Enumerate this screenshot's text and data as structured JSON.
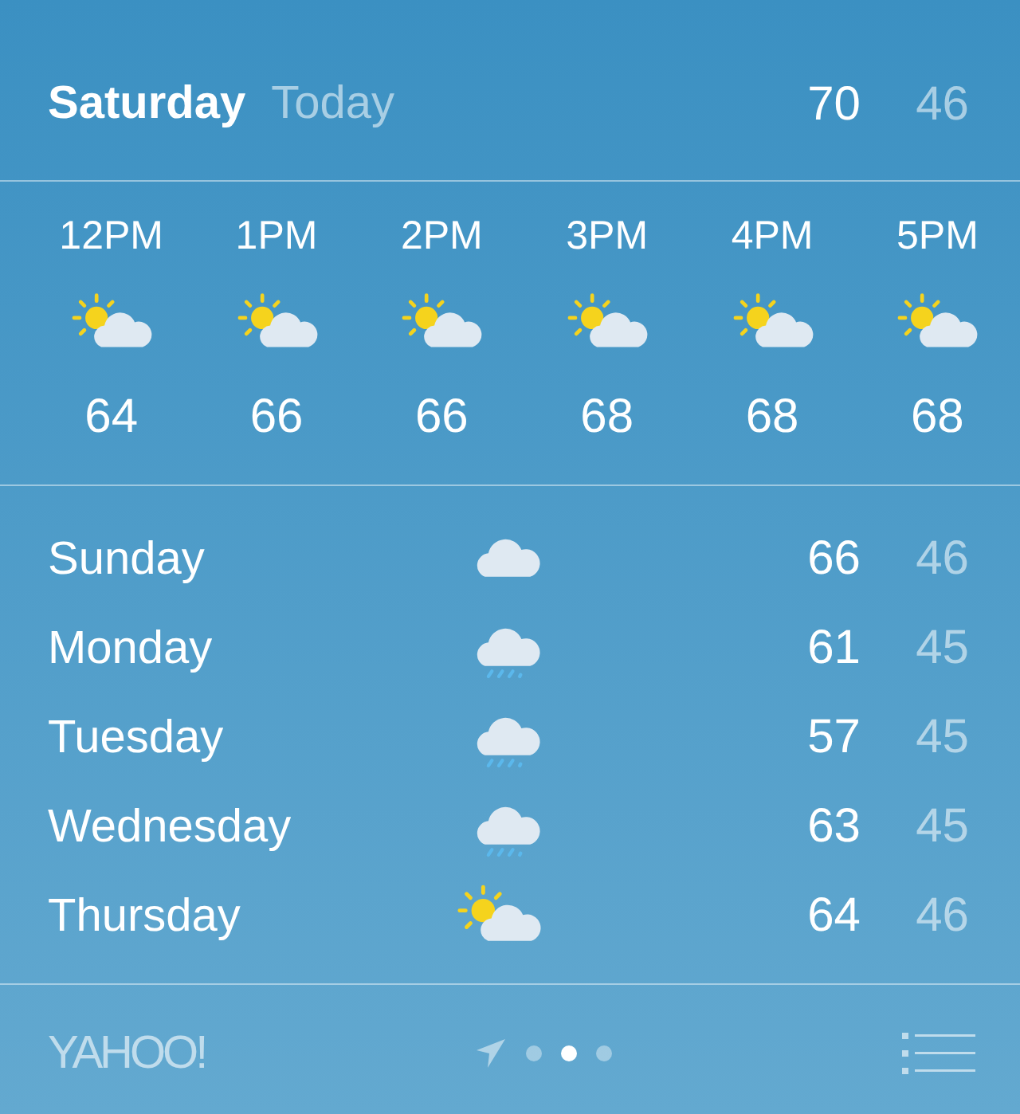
{
  "today": {
    "day": "Saturday",
    "label": "Today",
    "high": "70",
    "low": "46"
  },
  "hourly": [
    {
      "time": "12PM",
      "kind": "partly-cloudy",
      "temp": "64"
    },
    {
      "time": "1PM",
      "kind": "partly-cloudy",
      "temp": "66"
    },
    {
      "time": "2PM",
      "kind": "partly-cloudy",
      "temp": "66"
    },
    {
      "time": "3PM",
      "kind": "partly-cloudy",
      "temp": "68"
    },
    {
      "time": "4PM",
      "kind": "partly-cloudy",
      "temp": "68"
    },
    {
      "time": "5PM",
      "kind": "partly-cloudy",
      "temp": "68"
    }
  ],
  "daily": [
    {
      "day": "Sunday",
      "kind": "cloudy",
      "high": "66",
      "low": "46"
    },
    {
      "day": "Monday",
      "kind": "rain",
      "high": "61",
      "low": "45"
    },
    {
      "day": "Tuesday",
      "kind": "rain",
      "high": "57",
      "low": "45"
    },
    {
      "day": "Wednesday",
      "kind": "rain",
      "high": "63",
      "low": "45"
    },
    {
      "day": "Thursday",
      "kind": "partly-cloudy",
      "high": "64",
      "low": "46"
    }
  ],
  "footer": {
    "logo": "YAHOO!",
    "pages": [
      {
        "selected": false
      },
      {
        "selected": true
      },
      {
        "selected": false
      }
    ]
  }
}
